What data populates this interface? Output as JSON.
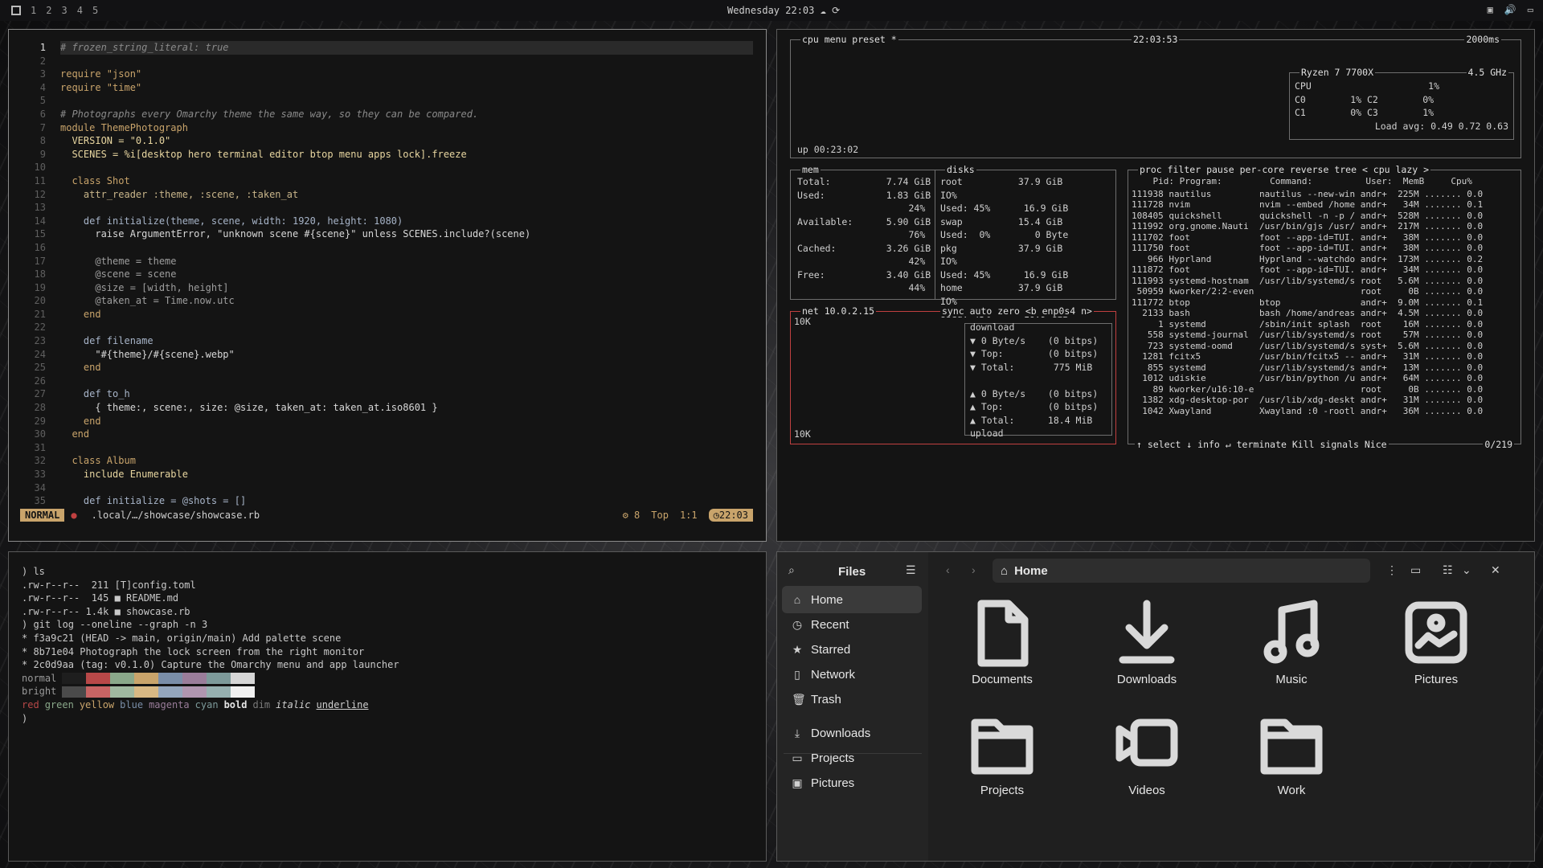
{
  "topbar": {
    "workspaces": [
      "1",
      "2",
      "3",
      "4",
      "5"
    ],
    "clock": "Wednesday 22:03"
  },
  "editor": {
    "lines": [
      {
        "n": "1",
        "t": "# frozen_string_literal: true",
        "c": "cm"
      },
      {
        "n": "2",
        "t": "",
        "c": ""
      },
      {
        "n": "3",
        "t": "require \"json\"",
        "c": "kw"
      },
      {
        "n": "4",
        "t": "require \"time\"",
        "c": "kw"
      },
      {
        "n": "5",
        "t": "",
        "c": ""
      },
      {
        "n": "6",
        "t": "# Photographs every Omarchy theme the same way, so they can be compared.",
        "c": "cm"
      },
      {
        "n": "7",
        "t": "module ThemePhotograph",
        "c": "kw"
      },
      {
        "n": "8",
        "t": "  VERSION = \"0.1.0\"",
        "c": "cn"
      },
      {
        "n": "9",
        "t": "  SCENES = %i[desktop hero terminal editor btop menu apps lock].freeze",
        "c": "cn"
      },
      {
        "n": "10",
        "t": "",
        "c": ""
      },
      {
        "n": "11",
        "t": "  class Shot",
        "c": "kw"
      },
      {
        "n": "12",
        "t": "    attr_reader :theme, :scene, :taken_at",
        "c": "sym"
      },
      {
        "n": "13",
        "t": "",
        "c": ""
      },
      {
        "n": "14",
        "t": "    def initialize(theme, scene, width: 1920, height: 1080)",
        "c": "fn"
      },
      {
        "n": "15",
        "t": "      raise ArgumentError, \"unknown scene #{scene}\" unless SCENES.include?(scene)",
        "c": "st"
      },
      {
        "n": "16",
        "t": "",
        "c": ""
      },
      {
        "n": "17",
        "t": "      @theme = theme",
        "c": "iv"
      },
      {
        "n": "18",
        "t": "      @scene = scene",
        "c": "iv"
      },
      {
        "n": "19",
        "t": "      @size = [width, height]",
        "c": "iv"
      },
      {
        "n": "20",
        "t": "      @taken_at = Time.now.utc",
        "c": "iv"
      },
      {
        "n": "21",
        "t": "    end",
        "c": "kw"
      },
      {
        "n": "22",
        "t": "",
        "c": ""
      },
      {
        "n": "23",
        "t": "    def filename",
        "c": "fn"
      },
      {
        "n": "24",
        "t": "      \"#{theme}/#{scene}.webp\"",
        "c": "st"
      },
      {
        "n": "25",
        "t": "    end",
        "c": "kw"
      },
      {
        "n": "26",
        "t": "",
        "c": ""
      },
      {
        "n": "27",
        "t": "    def to_h",
        "c": "fn"
      },
      {
        "n": "28",
        "t": "      { theme:, scene:, size: @size, taken_at: taken_at.iso8601 }",
        "c": "st"
      },
      {
        "n": "29",
        "t": "    end",
        "c": "kw"
      },
      {
        "n": "30",
        "t": "  end",
        "c": "kw"
      },
      {
        "n": "31",
        "t": "",
        "c": ""
      },
      {
        "n": "32",
        "t": "  class Album",
        "c": "kw"
      },
      {
        "n": "33",
        "t": "    include Enumerable",
        "c": "cn"
      },
      {
        "n": "34",
        "t": "",
        "c": ""
      },
      {
        "n": "35",
        "t": "    def initialize = @shots = []",
        "c": "fn"
      }
    ],
    "status": {
      "mode": "NORMAL",
      "path": ".local/…/showcase/showcase.rb",
      "lsp": "8",
      "pos": "Top",
      "cursor": "1:1",
      "time": "22:03"
    }
  },
  "btop": {
    "cpu": {
      "tabs": "cpu menu preset *",
      "time": "22:03:53",
      "interval": "2000ms",
      "uptime": "up 00:23:02",
      "model": "Ryzen 7 7700X",
      "freq": "4.5 GHz",
      "cpu_pct": 0.01,
      "rows": [
        "CPU                     1%",
        "C0        1% C2        0%",
        "C1        0% C3        1%"
      ],
      "load": "Load avg: 0.49 0.72 0.63"
    },
    "mem": {
      "label": "mem",
      "lines": [
        "Total:          7.74 GiB",
        "Used:           1.83 GiB",
        "                    24%",
        "Available:      5.90 GiB",
        "                    76%",
        "Cached:         3.26 GiB",
        "                    42%",
        "Free:           3.40 GiB",
        "                    44%"
      ]
    },
    "disks": {
      "label": "disks",
      "lines": [
        "root          37.9 GiB",
        "IO%",
        "Used: 45%      16.9 GiB",
        "swap          15.4 GiB",
        "Used:  0%        0 Byte",
        "pkg           37.9 GiB",
        "IO%",
        "Used: 45%      16.9 GiB",
        "home          37.9 GiB",
        "IO%",
        "Used: 45%      16.9 GiB"
      ]
    },
    "net": {
      "label": "net 10.0.2.15",
      "tags": "sync auto zero <b enp0s4 n>",
      "scale_top": "10K",
      "scale_bot": "10K",
      "lines": [
        "download",
        "▼ 0 Byte/s    (0 bitps)",
        "▼ Top:        (0 bitps)",
        "▼ Total:       775 MiB",
        "",
        "▲ 0 Byte/s    (0 bitps)",
        "▲ Top:        (0 bitps)",
        "▲ Total:      18.4 MiB",
        "upload"
      ]
    },
    "proc": {
      "tabs": "proc filter   pause per-core reverse tree < cpu lazy >",
      "header": "    Pid: Program:         Command:          User:  MemB     Cpu%",
      "rows": [
        "111938 nautilus         nautilus --new-win andr+  225M ....... 0.0",
        "111728 nvim             nvim --embed /home andr+   34M ....... 0.1",
        "108405 quickshell       quickshell -n -p / andr+  528M ....... 0.0",
        "111992 org.gnome.Nauti  /usr/bin/gjs /usr/ andr+  217M ....... 0.0",
        "111702 foot             foot --app-id=TUI. andr+   38M ....... 0.0",
        "111750 foot             foot --app-id=TUI. andr+   38M ....... 0.0",
        "   966 Hyprland         Hyprland --watchdo andr+  173M ....... 0.2",
        "111872 foot             foot --app-id=TUI. andr+   34M ....... 0.0",
        "111993 systemd-hostnam  /usr/lib/systemd/s root   5.6M ....... 0.0",
        " 50959 kworker/2:2-even                    root     0B ....... 0.0",
        "111772 btop             btop               andr+  9.0M ....... 0.1",
        "  2133 bash             bash /home/andreas andr+  4.5M ....... 0.0",
        "     1 systemd          /sbin/init splash  root    16M ....... 0.0",
        "   558 systemd-journal  /usr/lib/systemd/s root    57M ....... 0.0",
        "   723 systemd-oomd     /usr/lib/systemd/s syst+  5.6M ....... 0.0",
        "  1281 fcitx5           /usr/bin/fcitx5 -- andr+   31M ....... 0.0",
        "   855 systemd          /usr/lib/systemd/s andr+   13M ....... 0.0",
        "  1012 udiskie          /usr/bin/python /u andr+   64M ....... 0.0",
        "    89 kworker/u16:10-e                    root     0B ....... 0.0",
        "  1382 xdg-desktop-por  /usr/lib/xdg-deskt andr+   31M ....... 0.0",
        "  1042 Xwayland         Xwayland :0 -rootl andr+   36M ....... 0.0"
      ],
      "footer": "↑ select ↓ info ↵ terminate Kill signals Nice",
      "count": "0/219"
    }
  },
  "terminal": {
    "lines": [
      ") ls",
      ".rw-r--r--  211 [T]config.toml",
      ".rw-r--r--  145 ■ README.md",
      ".rw-r--r-- 1.4k ■ showcase.rb",
      ") git log --oneline --graph -n 3",
      "* f3a9c21 (HEAD -> main, origin/main) Add palette scene",
      "* 8b71e04 Photograph the lock screen from the right monitor",
      "* 2c0d9aa (tag: v0.1.0) Capture the Omarchy menu and app launcher"
    ],
    "normal_label": "normal",
    "bright_label": "bright",
    "normal_colors": [
      "#1e1e1e",
      "#b84848",
      "#8aa88a",
      "#c9a46b",
      "#7a8ea8",
      "#9a7d9a",
      "#7d9a9a",
      "#d6d6d6"
    ],
    "bright_colors": [
      "#4a4a4a",
      "#c86464",
      "#a0b8a0",
      "#d8b884",
      "#94a6bc",
      "#b096b0",
      "#96b0b0",
      "#f0f0f0"
    ],
    "styles": [
      "red",
      "green",
      "yellow",
      "blue",
      "magenta",
      "cyan",
      "bold",
      "dim",
      "italic",
      "underline"
    ],
    "prompt": ")"
  },
  "files": {
    "title": "Files",
    "path": "Home",
    "sidebar": [
      {
        "label": "Home",
        "icon": "home-icon"
      },
      {
        "label": "Recent",
        "icon": "clock-icon"
      },
      {
        "label": "Starred",
        "icon": "star-icon"
      },
      {
        "label": "Network",
        "icon": "network-icon"
      },
      {
        "label": "Trash",
        "icon": "trash-icon"
      },
      {
        "label": "Downloads",
        "icon": "download-icon"
      },
      {
        "label": "Projects",
        "icon": "folder-icon"
      },
      {
        "label": "Pictures",
        "icon": "picture-icon"
      }
    ],
    "items": [
      {
        "label": "Documents",
        "icon": "document-icon"
      },
      {
        "label": "Downloads",
        "icon": "download-icon"
      },
      {
        "label": "Music",
        "icon": "music-icon"
      },
      {
        "label": "Pictures",
        "icon": "picture-icon"
      },
      {
        "label": "Projects",
        "icon": "folder-icon"
      },
      {
        "label": "Videos",
        "icon": "video-icon"
      },
      {
        "label": "Work",
        "icon": "folder-icon"
      }
    ]
  }
}
